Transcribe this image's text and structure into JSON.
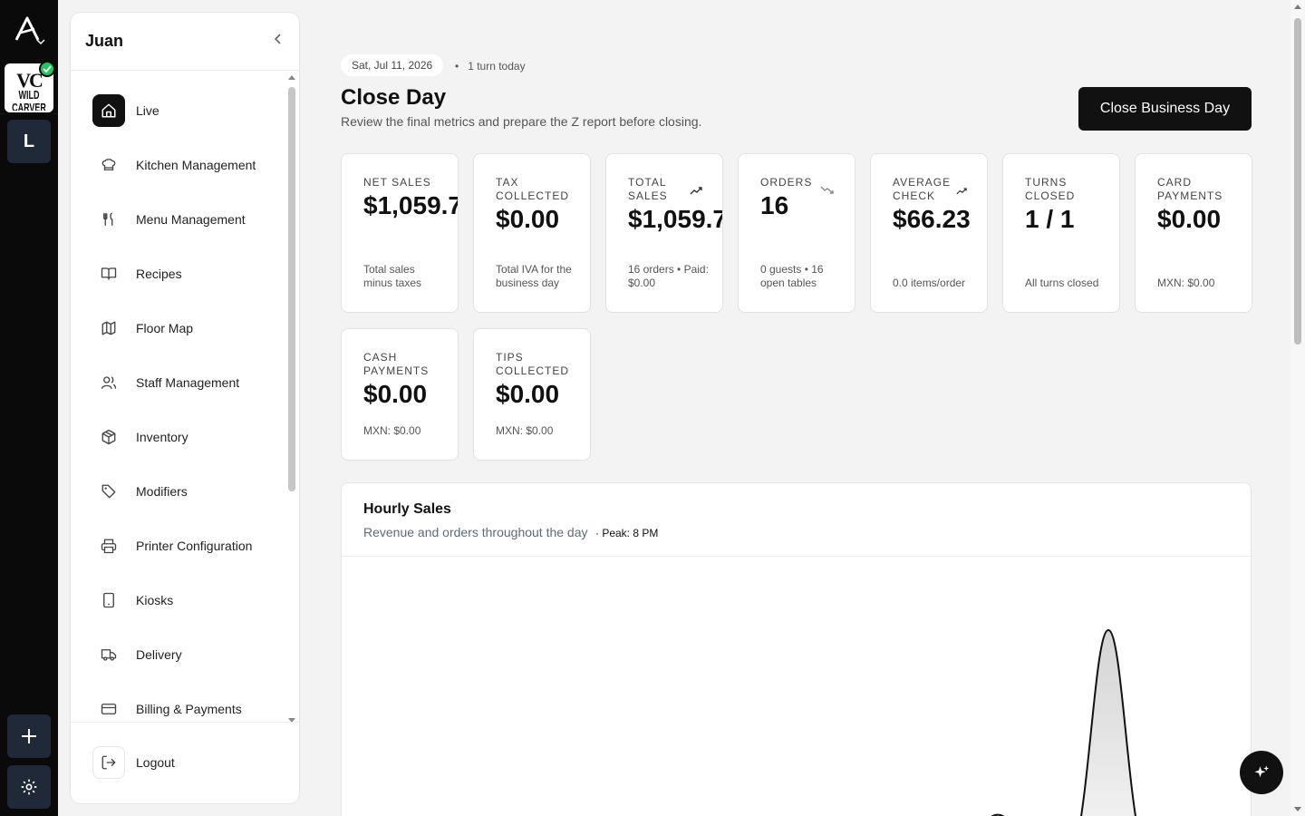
{
  "sidebar": {
    "user_name": "Juan",
    "items": [
      {
        "label": "Live",
        "icon": "home-icon",
        "active": true
      },
      {
        "label": "Kitchen Management",
        "icon": "chef-hat-icon"
      },
      {
        "label": "Menu Management",
        "icon": "utensils-icon"
      },
      {
        "label": "Recipes",
        "icon": "book-open-icon"
      },
      {
        "label": "Floor Map",
        "icon": "map-icon"
      },
      {
        "label": "Staff Management",
        "icon": "users-icon"
      },
      {
        "label": "Inventory",
        "icon": "package-icon"
      },
      {
        "label": "Modifiers",
        "icon": "tag-icon"
      },
      {
        "label": "Printer Configuration",
        "icon": "printer-icon"
      },
      {
        "label": "Kiosks",
        "icon": "tablet-icon"
      },
      {
        "label": "Delivery",
        "icon": "truck-icon"
      },
      {
        "label": "Billing & Payments",
        "icon": "credit-card-icon"
      }
    ],
    "logout_label": "Logout"
  },
  "rail": {
    "brand_mono": "VC",
    "brand_name": "WILD CARVER",
    "workspace_initial": "L"
  },
  "header": {
    "date": "Sat, Jul 11, 2026",
    "turns": "1 turn today",
    "title": "Close Day",
    "subtitle": "Review the final metrics and prepare the Z report before closing.",
    "close_button": "Close Business Day"
  },
  "metrics": [
    {
      "label": "Net Sales",
      "value": "$1,059.7",
      "note": "Total sales minus taxes"
    },
    {
      "label": "Tax Collected",
      "value": "$0.00",
      "note": "Total IVA for the business day"
    },
    {
      "label": "Total Sales",
      "value": "$1,059.7",
      "note": "16 orders • Paid: $0.00",
      "trend": "up"
    },
    {
      "label": "Orders",
      "value": "16",
      "note": "0 guests • 16 open tables",
      "trend": "down"
    },
    {
      "label": "Average Check",
      "value": "$66.23",
      "note": "0.0 items/order",
      "trend": "up"
    },
    {
      "label": "Turns Closed",
      "value": "1 / 1",
      "note": "All turns closed"
    },
    {
      "label": "Card Payments",
      "value": "$0.00",
      "note": "MXN: $0.00"
    },
    {
      "label": "Cash Payments",
      "value": "$0.00",
      "note": "MXN: $0.00"
    },
    {
      "label": "Tips Collected",
      "value": "$0.00",
      "note": "MXN: $0.00"
    }
  ],
  "hourly": {
    "title": "Hourly Sales",
    "subtitle": "Revenue and orders throughout the day",
    "peak": "· Peak: 8 PM"
  }
}
